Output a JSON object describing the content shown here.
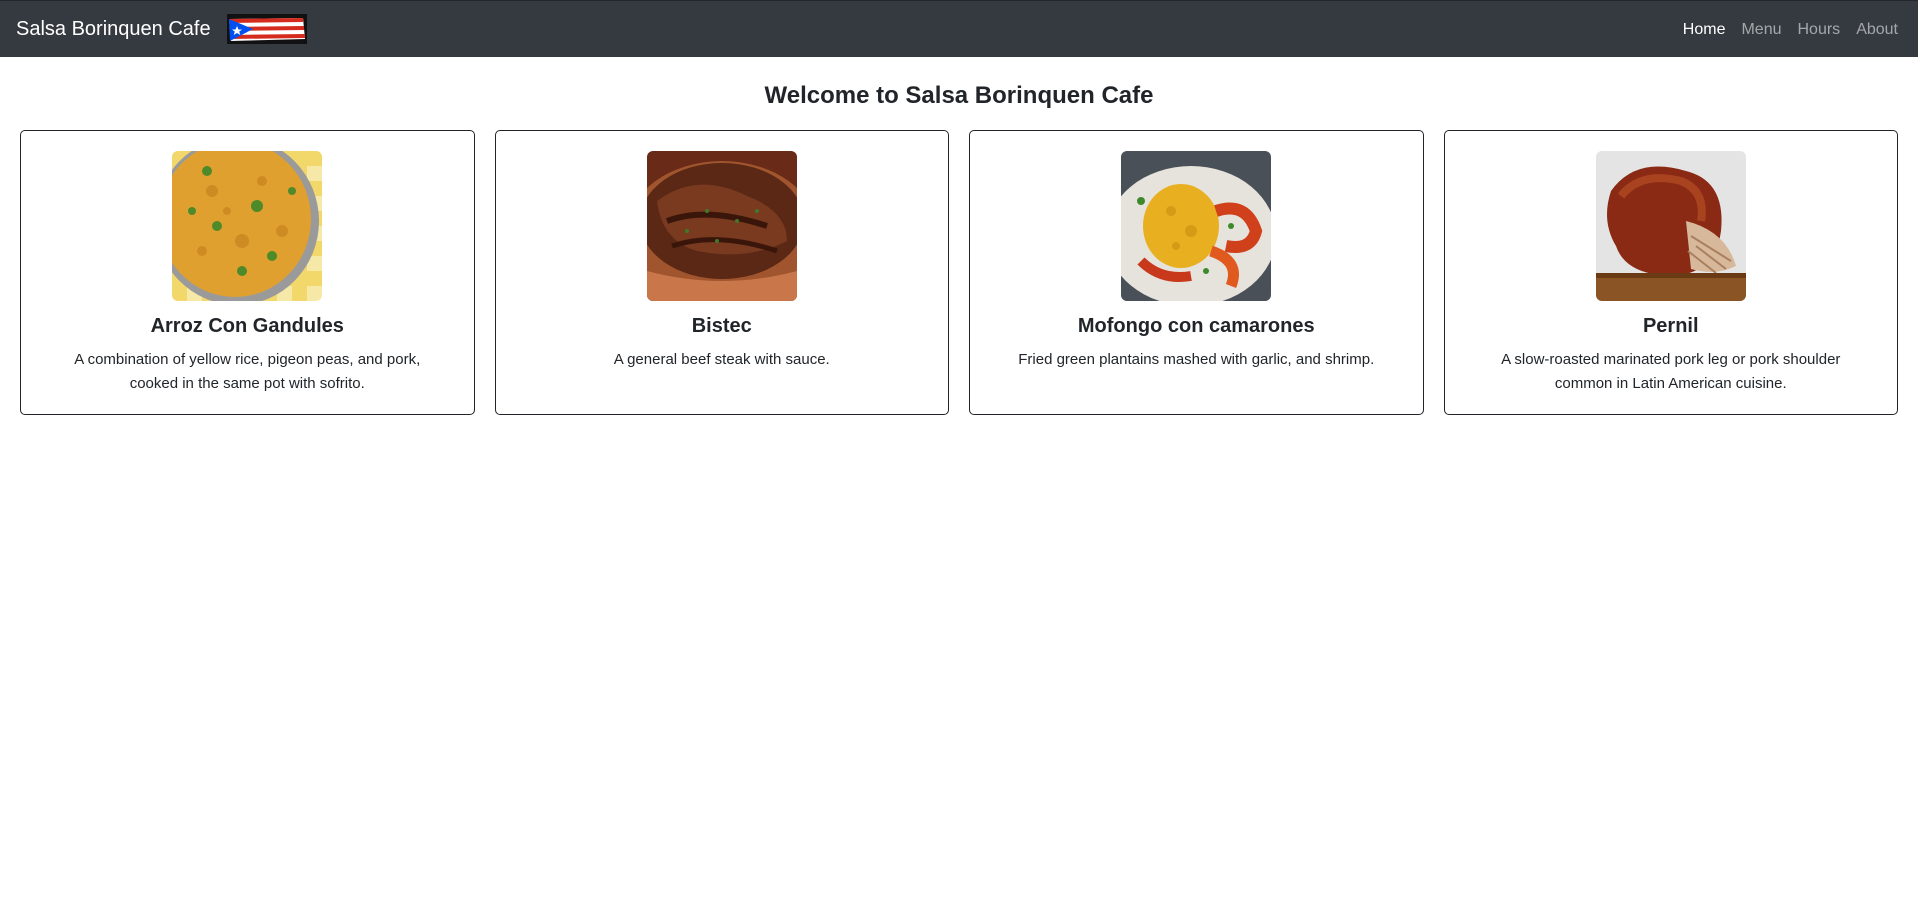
{
  "navbar": {
    "brand": "Salsa Borinquen Cafe",
    "links": [
      {
        "label": "Home",
        "active": true
      },
      {
        "label": "Menu",
        "active": false
      },
      {
        "label": "Hours",
        "active": false
      },
      {
        "label": "About",
        "active": false
      }
    ],
    "background": "#343a40"
  },
  "page": {
    "title": "Welcome to Salsa Borinquen Cafe"
  },
  "dishes": [
    {
      "name": "Arroz Con Gandules",
      "description": "A combination of yellow rice, pigeon peas, and pork, cooked in the same pot with sofrito."
    },
    {
      "name": "Bistec",
      "description": "A general beef steak with sauce."
    },
    {
      "name": "Mofongo con camarones",
      "description": "Fried green plantains mashed with garlic, and shrimp."
    },
    {
      "name": "Pernil",
      "description": "A slow-roasted marinated pork leg or pork shoulder common in Latin American cuisine."
    }
  ]
}
